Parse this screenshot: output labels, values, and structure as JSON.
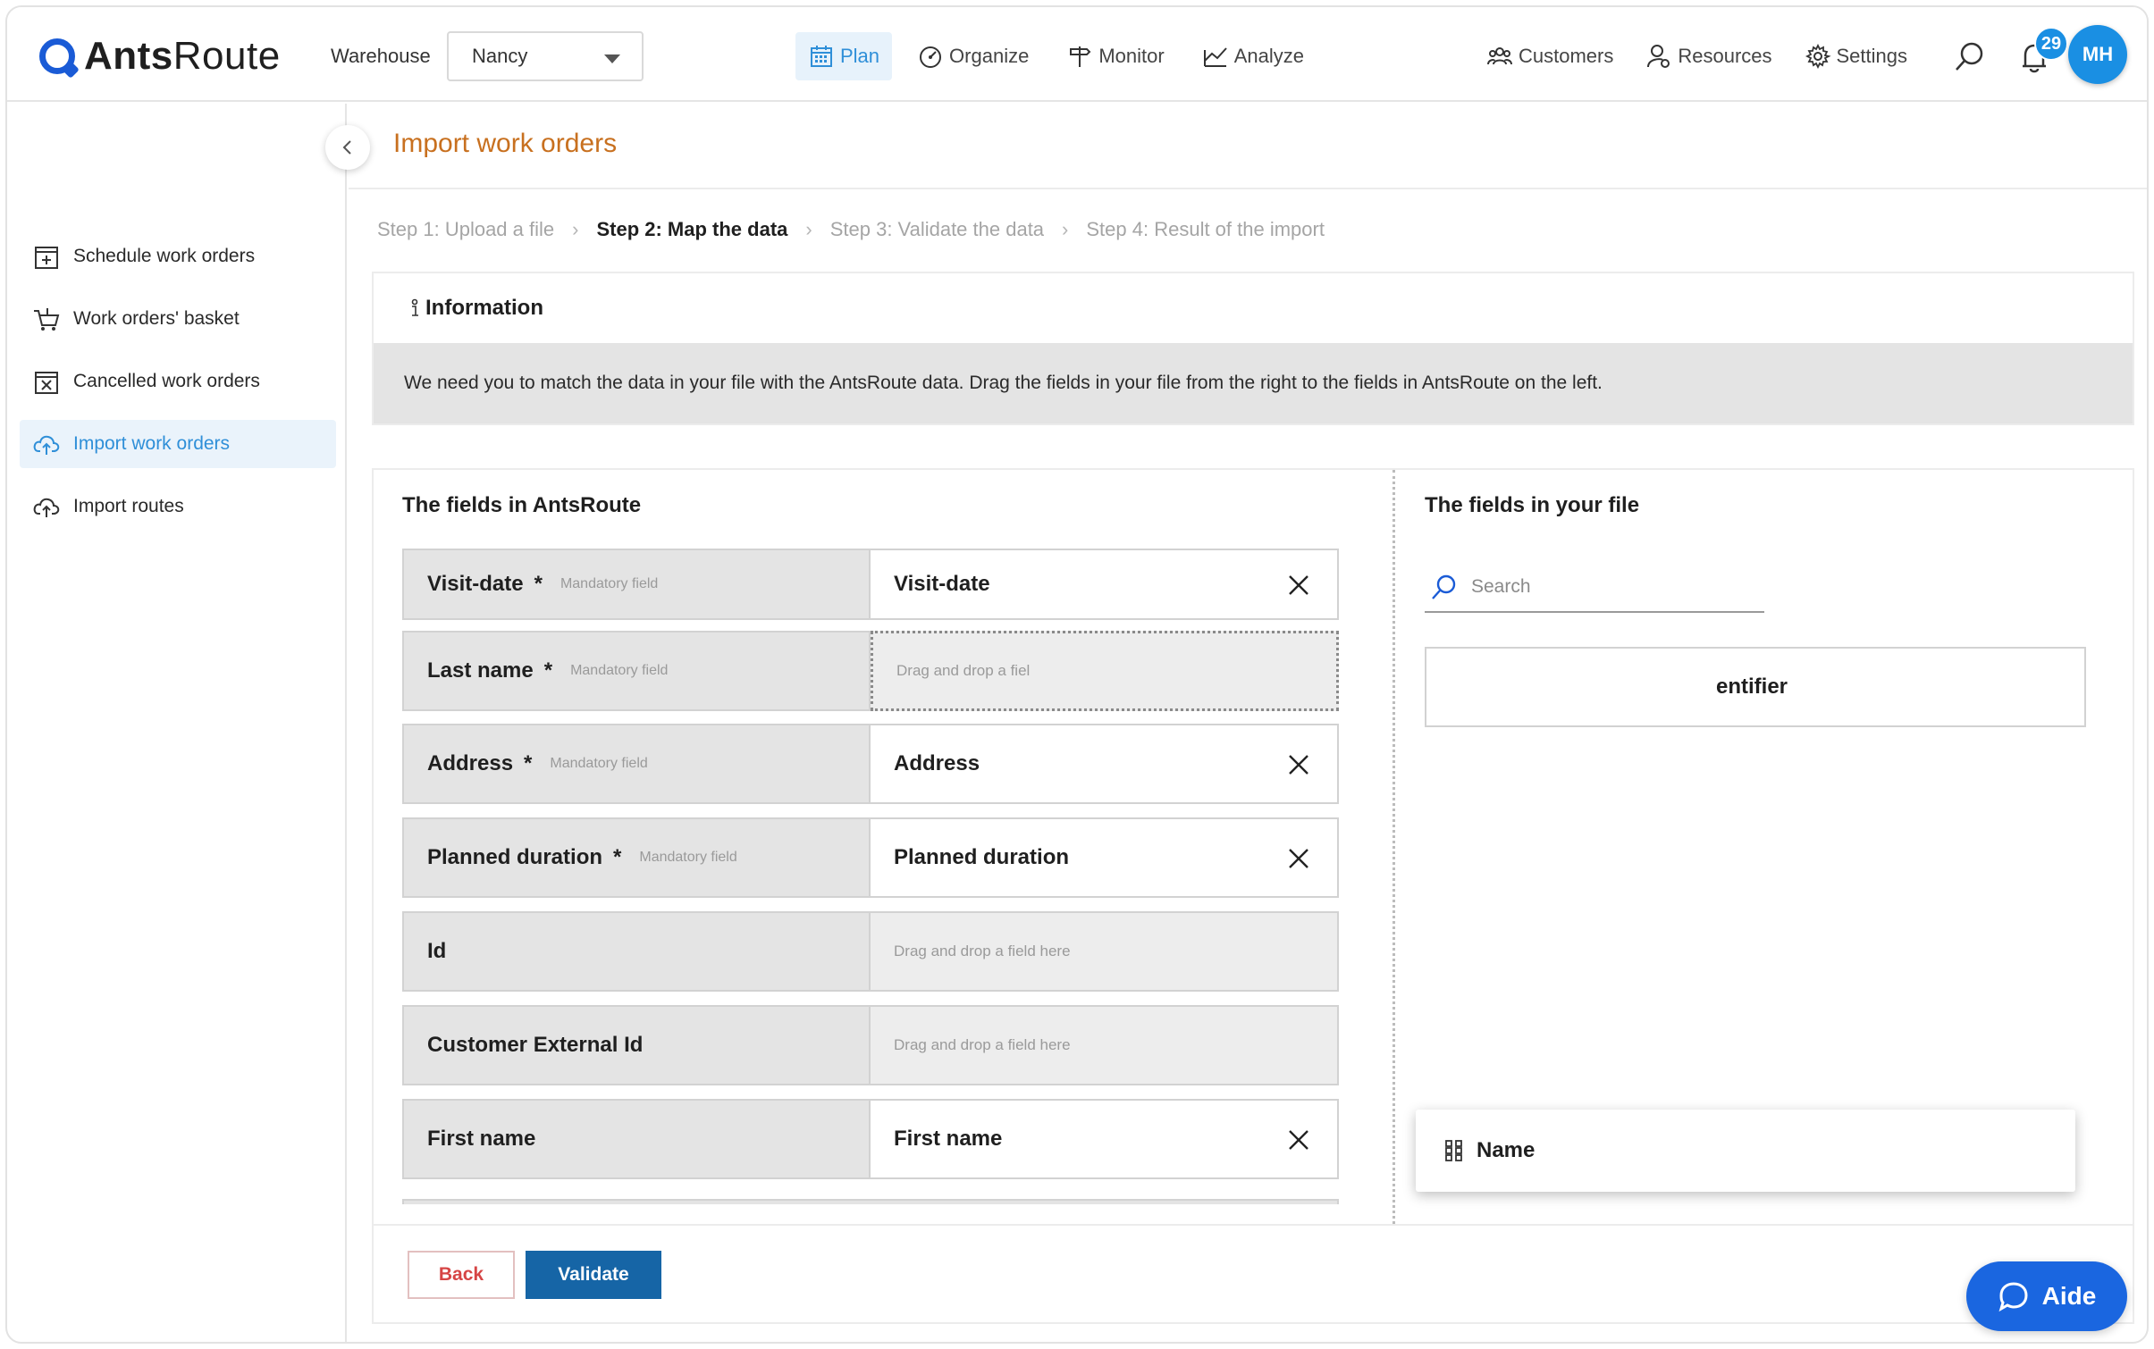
{
  "brand": {
    "name_bold": "Ants",
    "name_rest": "Route"
  },
  "topbar": {
    "warehouse_label": "Warehouse",
    "warehouse_value": "Nancy",
    "nav": [
      {
        "label": "Plan",
        "icon": "calendar-icon",
        "active": true
      },
      {
        "label": "Organize",
        "icon": "gauge-icon"
      },
      {
        "label": "Monitor",
        "icon": "signpost-icon"
      },
      {
        "label": "Analyze",
        "icon": "chart-icon"
      }
    ],
    "right_nav": [
      {
        "label": "Customers",
        "icon": "customers-icon"
      },
      {
        "label": "Resources",
        "icon": "resources-icon"
      },
      {
        "label": "Settings",
        "icon": "gear-icon"
      }
    ],
    "notification_count": "29",
    "avatar_initials": "MH"
  },
  "sidebar": {
    "items": [
      {
        "label": "Schedule work orders",
        "icon": "calendar-plus-icon"
      },
      {
        "label": "Work orders' basket",
        "icon": "basket-icon"
      },
      {
        "label": "Cancelled work orders",
        "icon": "calendar-x-icon"
      },
      {
        "label": "Import work orders",
        "icon": "cloud-upload-icon",
        "active": true
      },
      {
        "label": "Import routes",
        "icon": "cloud-upload-icon"
      }
    ]
  },
  "page": {
    "title": "Import work orders",
    "steps": [
      {
        "label": "Step 1: Upload a file"
      },
      {
        "label": "Step 2: Map the data",
        "current": true
      },
      {
        "label": "Step 3: Validate the data"
      },
      {
        "label": "Step 4: Result of the import"
      }
    ],
    "info": {
      "title": "Information",
      "text": "We need you to match the data in your file with the AntsRoute data. Drag the fields in your file from the right to the fields in AntsRoute on the left."
    }
  },
  "mapping": {
    "left_title": "The fields in AntsRoute",
    "right_title": "The fields in your file",
    "mandatory_text": "Mandatory field",
    "drop_placeholder": "Drag and drop a field here",
    "drop_placeholder_partial": "Drag and drop a fiel",
    "rows": [
      {
        "label": "Visit-date",
        "mandatory": "*",
        "value": "Visit-date"
      },
      {
        "label": "Last name",
        "mandatory": "*",
        "value": ""
      },
      {
        "label": "Address",
        "mandatory": "*",
        "value": "Address"
      },
      {
        "label": "Planned duration",
        "mandatory": "*",
        "value": "Planned duration"
      },
      {
        "label": "Id",
        "value": ""
      },
      {
        "label": "Customer External Id",
        "value": ""
      },
      {
        "label": "First name",
        "value": "First name"
      }
    ],
    "search_placeholder": "Search",
    "file_fields": [
      "entifier"
    ],
    "dragging_field": "Name"
  },
  "actions": {
    "back": "Back",
    "validate": "Validate"
  },
  "help": {
    "label": "Aide"
  },
  "colors": {
    "accent": "#2f8fd8",
    "title": "#c8701f",
    "primary_button": "#1665a6",
    "back_text": "#d64545",
    "aide": "#1a66e0"
  }
}
